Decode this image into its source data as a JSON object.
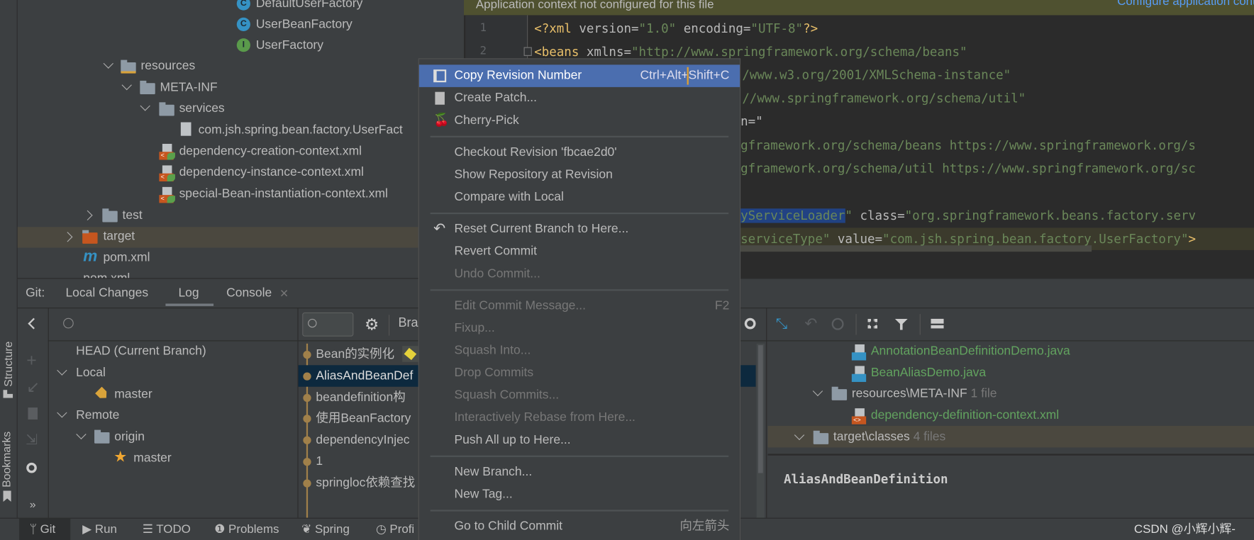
{
  "project_tree": {
    "items": [
      {
        "label": "DefaultUserFactory",
        "kind": "class"
      },
      {
        "label": "UserBeanFactory",
        "kind": "class"
      },
      {
        "label": "UserFactory",
        "kind": "interface"
      },
      {
        "label": "resources"
      },
      {
        "label": "META-INF"
      },
      {
        "label": "services"
      },
      {
        "label": "com.jsh.spring.bean.factory.UserFact"
      },
      {
        "label": "dependency-creation-context.xml"
      },
      {
        "label": "dependency-instance-context.xml"
      },
      {
        "label": "special-Bean-instantiation-context.xml"
      },
      {
        "label": "test"
      },
      {
        "label": "target"
      },
      {
        "label": "pom.xml"
      },
      {
        "label": "pom.xml"
      }
    ],
    "class_badge": "C",
    "interface_badge": "I",
    "maven_badge": "m"
  },
  "side_strip": {
    "structure": "Structure",
    "bookmarks": "Bookmarks"
  },
  "editor": {
    "banner": "Application context not configured for this file",
    "banner_link": "Configure application context",
    "line_numbers": [
      "1",
      "2"
    ],
    "line1": {
      "a": "<?xml ",
      "b": "version",
      "c": "=",
      "d": "\"1.0\"",
      "e": " encoding",
      "f": "=",
      "g": "\"UTF-8\"",
      "h": "?>"
    },
    "line2": {
      "a": "<beans ",
      "b": "xmlns",
      "c": "=",
      "d": "\"http://www.springframework.org/schema/beans\""
    },
    "line3": "/www.w3.org/2001/XMLSchema-instance\"",
    "line4": "//www.springframework.org/schema/util\"",
    "line5": "n=\"",
    "line6": "gframework.org/schema/beans https://www.springframework.org/s",
    "line7": "gframework.org/schema/util https://www.springframework.org/sc",
    "line9": {
      "selected": "yServiceLoader",
      "a": "\" ",
      "b": "class",
      "c": "=",
      "d": "\"org.springframework.beans.factory.serv"
    },
    "line10": {
      "a": "serviceType\"",
      "b": " value",
      "c": "=",
      "d": "\"com.jsh.spring.bean.factory.UserFactory\"",
      "e": ">"
    }
  },
  "git_window": {
    "label": "Git:",
    "tabs": [
      {
        "label": "Local Changes"
      },
      {
        "label": "Log",
        "active": true
      },
      {
        "label": "Console",
        "closable": true
      }
    ],
    "close_glyph": "×"
  },
  "branches": {
    "head": "HEAD (Current Branch)",
    "local": "Local",
    "local_master": "master",
    "remote": "Remote",
    "origin": "origin",
    "origin_master": "master"
  },
  "log": {
    "branch_filter": "Bra",
    "commits": [
      "Bean的实例化",
      "AliasAndBeanDef",
      "beandefinition构",
      "使用BeanFactory",
      "dependencyInjec",
      "1",
      "springloc依赖查找"
    ],
    "selected_index": 1
  },
  "changes": {
    "files": [
      {
        "label": "AnnotationBeanDefinitionDemo.java"
      },
      {
        "label": "BeanAliasDemo.java"
      }
    ],
    "dir1": "resources\\META-INF",
    "dir1_count": "1 file",
    "dir1_file": "dependency-definition-context.xml",
    "dir2": "target\\classes",
    "dir2_count": "4 files",
    "commit_title": "AliasAndBeanDefinition"
  },
  "context_menu": {
    "items": [
      {
        "label": "Copy Revision Number",
        "shortcut": "Ctrl+Alt+Shift+C",
        "icon": "copy-icon",
        "selected": true
      },
      {
        "label": "Create Patch...",
        "icon": "patch-icon"
      },
      {
        "label": "Cherry-Pick",
        "icon": "cherry-icon"
      },
      {
        "label": "Checkout Revision 'fbcae2d0'"
      },
      {
        "label": "Show Repository at Revision"
      },
      {
        "label": "Compare with Local"
      },
      {
        "label": "Reset Current Branch to Here...",
        "icon": "undo-icon"
      },
      {
        "label": "Revert Commit"
      },
      {
        "label": "Undo Commit...",
        "disabled": true
      },
      {
        "label": "Edit Commit Message...",
        "shortcut": "F2",
        "disabled": true
      },
      {
        "label": "Fixup...",
        "disabled": true
      },
      {
        "label": "Squash Into...",
        "disabled": true
      },
      {
        "label": "Drop Commits",
        "disabled": true
      },
      {
        "label": "Squash Commits...",
        "disabled": true
      },
      {
        "label": "Interactively Rebase from Here...",
        "disabled": true
      },
      {
        "label": "Push All up to Here..."
      },
      {
        "label": "New Branch..."
      },
      {
        "label": "New Tag..."
      },
      {
        "label": "Go to Child Commit",
        "shortcut": "向左箭头"
      }
    ]
  },
  "status_bar": {
    "items": [
      {
        "label": "Git",
        "active": true
      },
      {
        "label": "Run"
      },
      {
        "label": "TODO"
      },
      {
        "label": "Problems"
      },
      {
        "label": "Spring"
      },
      {
        "label": "Profi"
      }
    ],
    "watermark": "CSDN @小辉小辉-"
  },
  "colors": {
    "selection": "#4b6eaf",
    "tag": "#e8bf6a",
    "string": "#6a8759",
    "added_file": "#62a35f",
    "graph": "#a0804a"
  }
}
